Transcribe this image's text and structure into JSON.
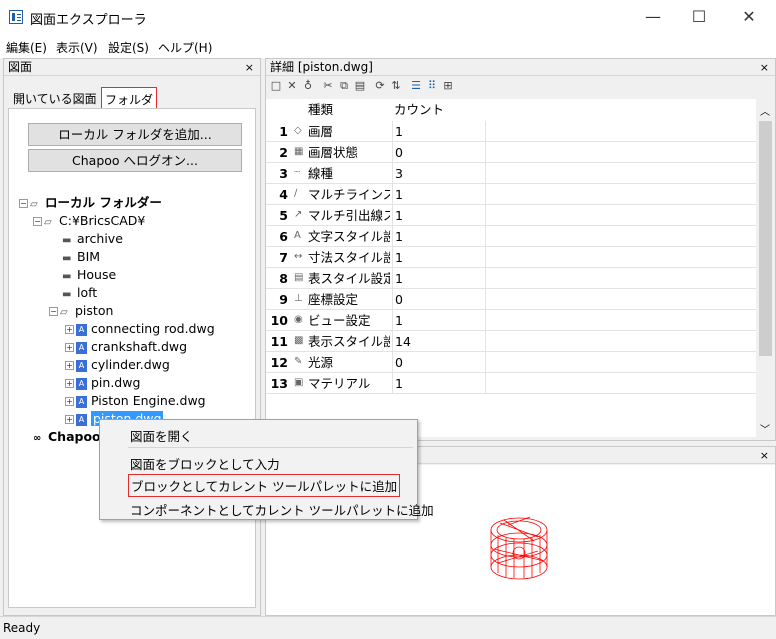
{
  "window": {
    "title": "図面エクスプローラ",
    "minimize": "—",
    "maximize": "☐",
    "close": "✕"
  },
  "menu": [
    "編集(E)",
    "表示(V)",
    "設定(S)",
    "ヘルプ(H)"
  ],
  "left_panel": {
    "title": "図面",
    "close": "×",
    "tabs": [
      "開いている図面",
      "フォルダ"
    ],
    "buttons": [
      "ローカル フォルダを追加...",
      "Chapoo へログオン..."
    ],
    "tree": {
      "root": "ローカル フォルダー",
      "bricscad": "C:¥BricsCAD¥",
      "folders": [
        "archive",
        "BIM",
        "House",
        "loft",
        "piston"
      ],
      "files": [
        "connecting rod.dwg",
        "crankshaft.dwg",
        "cylinder.dwg",
        "pin.dwg",
        "Piston Engine.dwg",
        "piston.dwg"
      ],
      "selected_partial": "piston.dwg",
      "chapoo": "Chapoo"
    }
  },
  "detail_panel": {
    "title": "詳細 [piston.dwg]",
    "close": "×",
    "columns": [
      "種類",
      "カウント"
    ],
    "rows": [
      {
        "num": "1",
        "icon": "layer-icon",
        "name": "画層",
        "count": "1"
      },
      {
        "num": "2",
        "icon": "layer-state-icon",
        "name": "画層状態",
        "count": "0"
      },
      {
        "num": "3",
        "icon": "linetype-icon",
        "name": "線種",
        "count": "3"
      },
      {
        "num": "4",
        "icon": "mline-icon",
        "name": "マルチラインスタ",
        "count": "1"
      },
      {
        "num": "5",
        "icon": "mleader-icon",
        "name": "マルチ引出線ス",
        "count": "1"
      },
      {
        "num": "6",
        "icon": "textstyle-icon",
        "name": "文字スタイル設",
        "count": "1"
      },
      {
        "num": "7",
        "icon": "dimstyle-icon",
        "name": "寸法スタイル設",
        "count": "1"
      },
      {
        "num": "8",
        "icon": "tablestyle-icon",
        "name": "表スタイル設定",
        "count": "1"
      },
      {
        "num": "9",
        "icon": "ucs-icon",
        "name": "座標設定",
        "count": "0"
      },
      {
        "num": "10",
        "icon": "view-icon",
        "name": "ビュー設定",
        "count": "1"
      },
      {
        "num": "11",
        "icon": "visualstyle-icon",
        "name": "表示スタイル設",
        "count": "14"
      },
      {
        "num": "12",
        "icon": "light-icon",
        "name": "光源",
        "count": "0"
      },
      {
        "num": "13",
        "icon": "material-icon",
        "name": "マテリアル",
        "count": "1"
      }
    ]
  },
  "preview_panel": {
    "close": "×"
  },
  "context_menu": {
    "items": [
      "図面を開く",
      "図面をブロックとして入力",
      "ブロックとしてカレント ツールパレットに追加",
      "コンポーネントとしてカレント ツールパレットに追加"
    ]
  },
  "status": "Ready",
  "colors": {
    "highlight": "#e32d2d",
    "selection": "#3399ff",
    "model": "#ff0000"
  }
}
